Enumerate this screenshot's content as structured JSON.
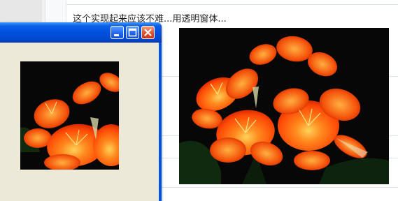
{
  "page": {
    "text": "这个实现起来应该不难...用透明窗体...",
    "photo_icon": "clivia-flower-photo"
  },
  "window": {
    "buttons": {
      "minimize_icon": "minimize-icon",
      "maximize_icon": "maximize-icon",
      "close_icon": "close-icon"
    },
    "photo_icon": "clivia-flower-photo-cropped"
  },
  "colors": {
    "titlebar": "#0054e3",
    "client_bg": "#ece9d8",
    "close_button": "#e0512c",
    "flower_orange": "#ff5a0a"
  }
}
